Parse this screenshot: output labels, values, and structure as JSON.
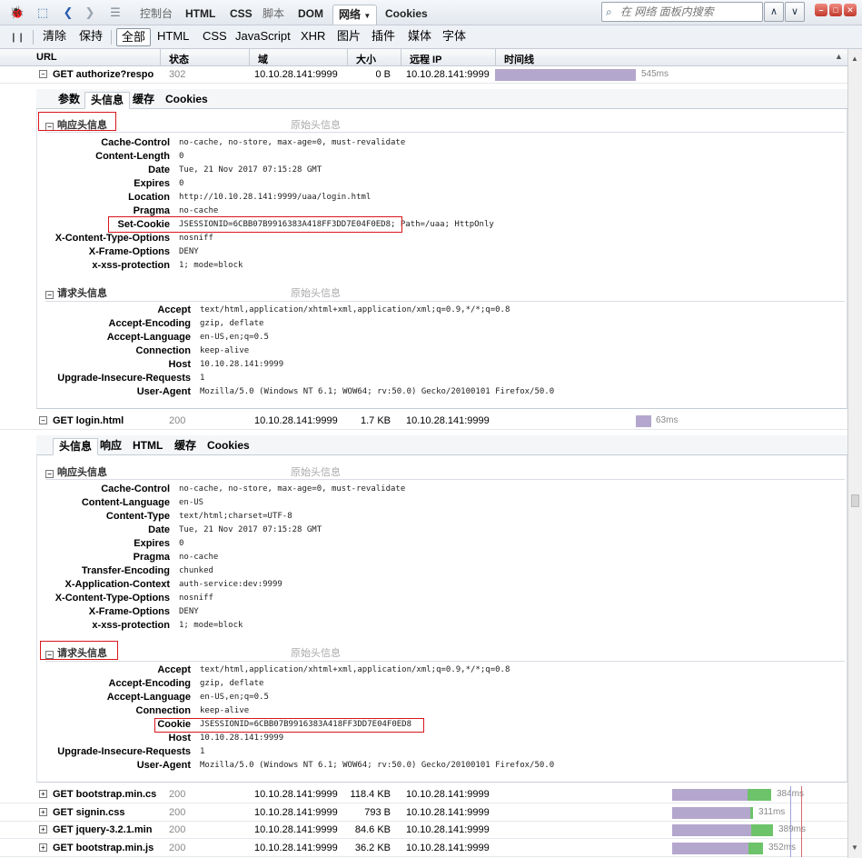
{
  "toolbar": {
    "main_tabs": [
      "控制台",
      "HTML",
      "CSS",
      "脚本",
      "DOM",
      "网络",
      "Cookies"
    ],
    "active_tab": "网络",
    "search_placeholder": "在 网络 面板内搜索"
  },
  "filter_bar": {
    "clear": "清除",
    "persist": "保持",
    "filters": [
      "全部",
      "HTML",
      "CSS",
      "JavaScript",
      "XHR",
      "图片",
      "插件",
      "媒体",
      "字体"
    ],
    "active_filter": "全部"
  },
  "columns": {
    "url": "URL",
    "status": "状态",
    "domain": "域",
    "size": "大小",
    "remote_ip": "远程 IP",
    "timeline": "时间线"
  },
  "requests": [
    {
      "name": "GET authorize?respo",
      "status": "302",
      "domain": "10.10.28.141:9999",
      "size": "0 B",
      "remote_ip": "10.10.28.141:9999",
      "time": "545ms",
      "expanded": true
    },
    {
      "name": "GET login.html",
      "status": "200",
      "domain": "10.10.28.141:9999",
      "size": "1.7 KB",
      "remote_ip": "10.10.28.141:9999",
      "time": "63ms",
      "expanded": true
    },
    {
      "name": "GET bootstrap.min.cs",
      "status": "200",
      "domain": "10.10.28.141:9999",
      "size": "118.4 KB",
      "remote_ip": "10.10.28.141:9999",
      "time": "384ms",
      "expanded": false
    },
    {
      "name": "GET signin.css",
      "status": "200",
      "domain": "10.10.28.141:9999",
      "size": "793 B",
      "remote_ip": "10.10.28.141:9999",
      "time": "311ms",
      "expanded": false
    },
    {
      "name": "GET jquery-3.2.1.min",
      "status": "200",
      "domain": "10.10.28.141:9999",
      "size": "84.6 KB",
      "remote_ip": "10.10.28.141:9999",
      "time": "389ms",
      "expanded": false
    },
    {
      "name": "GET bootstrap.min.js",
      "status": "200",
      "domain": "10.10.28.141:9999",
      "size": "36.2 KB",
      "remote_ip": "10.10.28.141:9999",
      "time": "352ms",
      "expanded": false
    }
  ],
  "detail1": {
    "tabs": [
      "参数",
      "头信息",
      "缓存",
      "Cookies"
    ],
    "active_tab": "头信息",
    "response_title": "响应头信息",
    "request_title": "请求头信息",
    "raw_label": "原始头信息",
    "response_headers": [
      {
        "k": "Cache-Control",
        "v": "no-cache, no-store, max-age=0, must-revalidate"
      },
      {
        "k": "Content-Length",
        "v": "0"
      },
      {
        "k": "Date",
        "v": "Tue, 21 Nov 2017 07:15:28 GMT"
      },
      {
        "k": "Expires",
        "v": "0"
      },
      {
        "k": "Location",
        "v": "http://10.10.28.141:9999/uaa/login.html"
      },
      {
        "k": "Pragma",
        "v": "no-cache"
      },
      {
        "k": "Set-Cookie",
        "v": "JSESSIONID=6CBB07B9916383A418FF3DD7E04F0ED8; Path=/uaa; HttpOnly"
      },
      {
        "k": "X-Content-Type-Options",
        "v": "nosniff"
      },
      {
        "k": "X-Frame-Options",
        "v": "DENY"
      },
      {
        "k": "x-xss-protection",
        "v": "1; mode=block"
      }
    ],
    "request_headers": [
      {
        "k": "Accept",
        "v": "text/html,application/xhtml+xml,application/xml;q=0.9,*/*;q=0.8"
      },
      {
        "k": "Accept-Encoding",
        "v": "gzip, deflate"
      },
      {
        "k": "Accept-Language",
        "v": "en-US,en;q=0.5"
      },
      {
        "k": "Connection",
        "v": "keep-alive"
      },
      {
        "k": "Host",
        "v": "10.10.28.141:9999"
      },
      {
        "k": "Upgrade-Insecure-Requests",
        "v": "1"
      },
      {
        "k": "User-Agent",
        "v": "Mozilla/5.0 (Windows NT 6.1; WOW64; rv:50.0) Gecko/20100101 Firefox/50.0"
      }
    ]
  },
  "detail2": {
    "tabs": [
      "头信息",
      "响应",
      "HTML",
      "缓存",
      "Cookies"
    ],
    "active_tab": "头信息",
    "response_title": "响应头信息",
    "request_title": "请求头信息",
    "raw_label": "原始头信息",
    "response_headers": [
      {
        "k": "Cache-Control",
        "v": "no-cache, no-store, max-age=0, must-revalidate"
      },
      {
        "k": "Content-Language",
        "v": "en-US"
      },
      {
        "k": "Content-Type",
        "v": "text/html;charset=UTF-8"
      },
      {
        "k": "Date",
        "v": "Tue, 21 Nov 2017 07:15:28 GMT"
      },
      {
        "k": "Expires",
        "v": "0"
      },
      {
        "k": "Pragma",
        "v": "no-cache"
      },
      {
        "k": "Transfer-Encoding",
        "v": "chunked"
      },
      {
        "k": "X-Application-Context",
        "v": "auth-service:dev:9999"
      },
      {
        "k": "X-Content-Type-Options",
        "v": "nosniff"
      },
      {
        "k": "X-Frame-Options",
        "v": "DENY"
      },
      {
        "k": "x-xss-protection",
        "v": "1; mode=block"
      }
    ],
    "request_headers": [
      {
        "k": "Accept",
        "v": "text/html,application/xhtml+xml,application/xml;q=0.9,*/*;q=0.8"
      },
      {
        "k": "Accept-Encoding",
        "v": "gzip, deflate"
      },
      {
        "k": "Accept-Language",
        "v": "en-US,en;q=0.5"
      },
      {
        "k": "Connection",
        "v": "keep-alive"
      },
      {
        "k": "Cookie",
        "v": "JSESSIONID=6CBB07B9916383A418FF3DD7E04F0ED8"
      },
      {
        "k": "Host",
        "v": "10.10.28.141:9999"
      },
      {
        "k": "Upgrade-Insecure-Requests",
        "v": "1"
      },
      {
        "k": "User-Agent",
        "v": "Mozilla/5.0 (Windows NT 6.1; WOW64; rv:50.0) Gecko/20100101 Firefox/50.0"
      }
    ]
  }
}
